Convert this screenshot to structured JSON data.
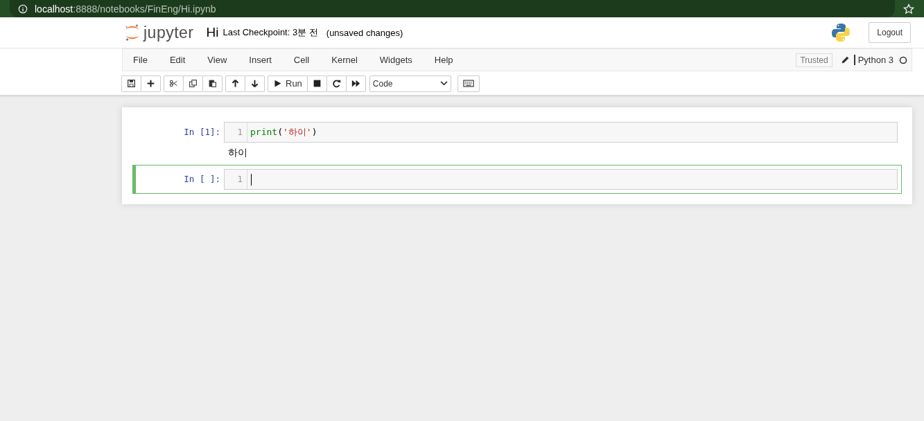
{
  "browser": {
    "host": "localhost",
    "path": ":8888/notebooks/FinEng/Hi.ipynb"
  },
  "header": {
    "logo": "jupyter",
    "notebook_name": "Hi",
    "checkpoint": "Last Checkpoint: 3분 전",
    "autosave_status": "(unsaved changes)",
    "logout": "Logout"
  },
  "menu": {
    "items": [
      "File",
      "Edit",
      "View",
      "Insert",
      "Cell",
      "Kernel",
      "Widgets",
      "Help"
    ],
    "trusted": "Trusted",
    "kernel_name": "Python 3"
  },
  "toolbar": {
    "groups": [
      {
        "buttons": [
          {
            "kind": "save"
          },
          {
            "kind": "add"
          }
        ]
      },
      {
        "buttons": [
          {
            "kind": "cut"
          },
          {
            "kind": "copy"
          },
          {
            "kind": "paste"
          }
        ]
      },
      {
        "buttons": [
          {
            "kind": "up"
          },
          {
            "kind": "down"
          }
        ]
      },
      {
        "buttons": [
          {
            "kind": "run",
            "label": "Run"
          },
          {
            "kind": "stop"
          },
          {
            "kind": "restart"
          },
          {
            "kind": "fastforward"
          }
        ]
      }
    ],
    "cell_type": "Code"
  },
  "cells": [
    {
      "prompt": "In [1]:",
      "line_number": "1",
      "selected": false,
      "tokens": [
        {
          "kind": "keyword",
          "text": "print"
        },
        {
          "kind": "punct",
          "text": "("
        },
        {
          "kind": "string",
          "text": "'하이'"
        },
        {
          "kind": "punct",
          "text": ")"
        }
      ],
      "output": "하이"
    },
    {
      "prompt": "In [ ]:",
      "line_number": "1",
      "selected": true
    }
  ]
}
